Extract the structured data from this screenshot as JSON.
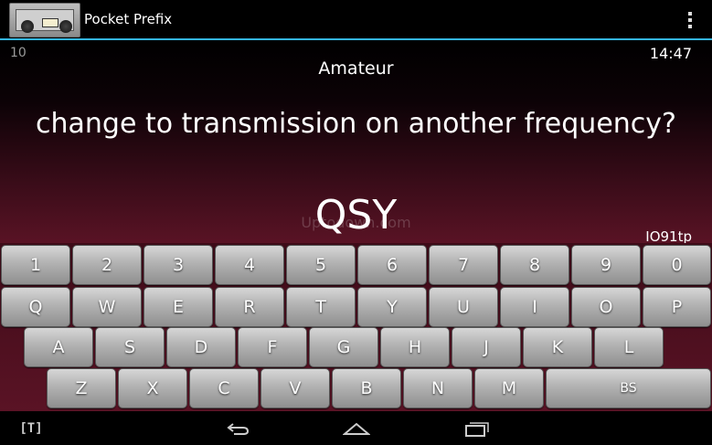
{
  "app": {
    "title": "Pocket Prefix"
  },
  "status": {
    "counter": "10",
    "clock": "14:47"
  },
  "quiz": {
    "category": "Amateur",
    "question": "change to transmission on another frequency?",
    "answer": "QSY",
    "watermark": "Uptodown.com",
    "locator": "IO91tp"
  },
  "keyboard": {
    "row1": [
      "1",
      "2",
      "3",
      "4",
      "5",
      "6",
      "7",
      "8",
      "9",
      "0"
    ],
    "row2": [
      "Q",
      "W",
      "E",
      "R",
      "T",
      "Y",
      "U",
      "I",
      "O",
      "P"
    ],
    "row3": [
      "A",
      "S",
      "D",
      "F",
      "G",
      "H",
      "J",
      "K",
      "L"
    ],
    "row4": [
      "Z",
      "X",
      "C",
      "V",
      "B",
      "N",
      "M",
      "BS"
    ]
  },
  "navbar": {
    "t_label": "[T]"
  },
  "colors": {
    "accent": "#33b5e5",
    "background_bottom": "#5a1325",
    "key": "#b2b2b2"
  },
  "icons": {
    "menu": "overflow-menu-icon",
    "back": "back-icon",
    "home": "home-icon",
    "recents": "recent-apps-icon"
  }
}
